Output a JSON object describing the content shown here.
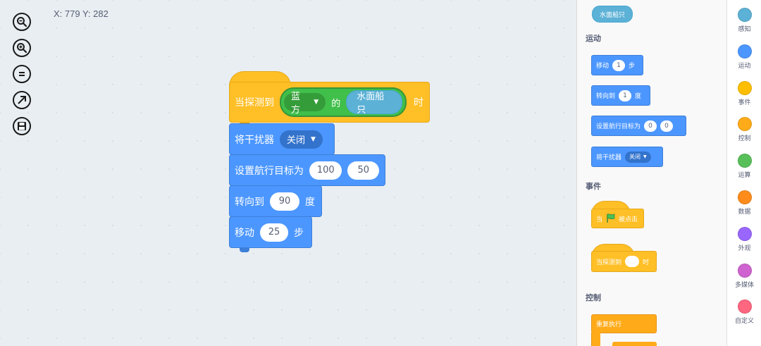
{
  "workspace": {
    "coords": "X: 779 Y: 282",
    "tools": [
      {
        "name": "zoom-out"
      },
      {
        "name": "zoom-in"
      },
      {
        "name": "zoom-reset"
      },
      {
        "name": "fullscreen"
      },
      {
        "name": "save"
      }
    ],
    "script": {
      "hat": {
        "prefix": "当探测到",
        "dropdown": "蓝方",
        "middle": "的",
        "reporter": "水面船只",
        "suffix": "时"
      },
      "jammer": {
        "label": "将干扰器",
        "dropdown": "关闭"
      },
      "target": {
        "label": "设置航行目标为",
        "x": "100",
        "y": "50"
      },
      "turn": {
        "label": "转向到",
        "value": "90",
        "unit": "度"
      },
      "move": {
        "label": "移动",
        "value": "25",
        "unit": "步"
      }
    }
  },
  "palette": {
    "sensing_reporter": "水面船只",
    "motion_title": "运动",
    "move_block": {
      "label": "移动",
      "value": "1",
      "unit": "步"
    },
    "turn_block": {
      "label": "转向到",
      "value": "1",
      "unit": "度"
    },
    "target_block": {
      "label": "设置航行目标为",
      "x": "0",
      "y": "0"
    },
    "jammer_block": {
      "label": "将干扰器",
      "dropdown": "关闭"
    },
    "events_title": "事件",
    "flag_block": {
      "prefix": "当",
      "suffix": "被点击"
    },
    "detect_block": {
      "prefix": "当探测到",
      "suffix": "时"
    },
    "control_title": "控制",
    "repeat_block": {
      "label": "重复执行"
    }
  },
  "categories": [
    {
      "label": "感知",
      "color": "#5cb1d6"
    },
    {
      "label": "运动",
      "color": "#4c97ff"
    },
    {
      "label": "事件",
      "color": "#ffbf00"
    },
    {
      "label": "控制",
      "color": "#ffab19"
    },
    {
      "label": "运算",
      "color": "#59c059"
    },
    {
      "label": "数据",
      "color": "#ff8c1a"
    },
    {
      "label": "外观",
      "color": "#9966ff"
    },
    {
      "label": "多媒体",
      "color": "#cf63cf"
    },
    {
      "label": "自定义",
      "color": "#ff6680"
    }
  ]
}
